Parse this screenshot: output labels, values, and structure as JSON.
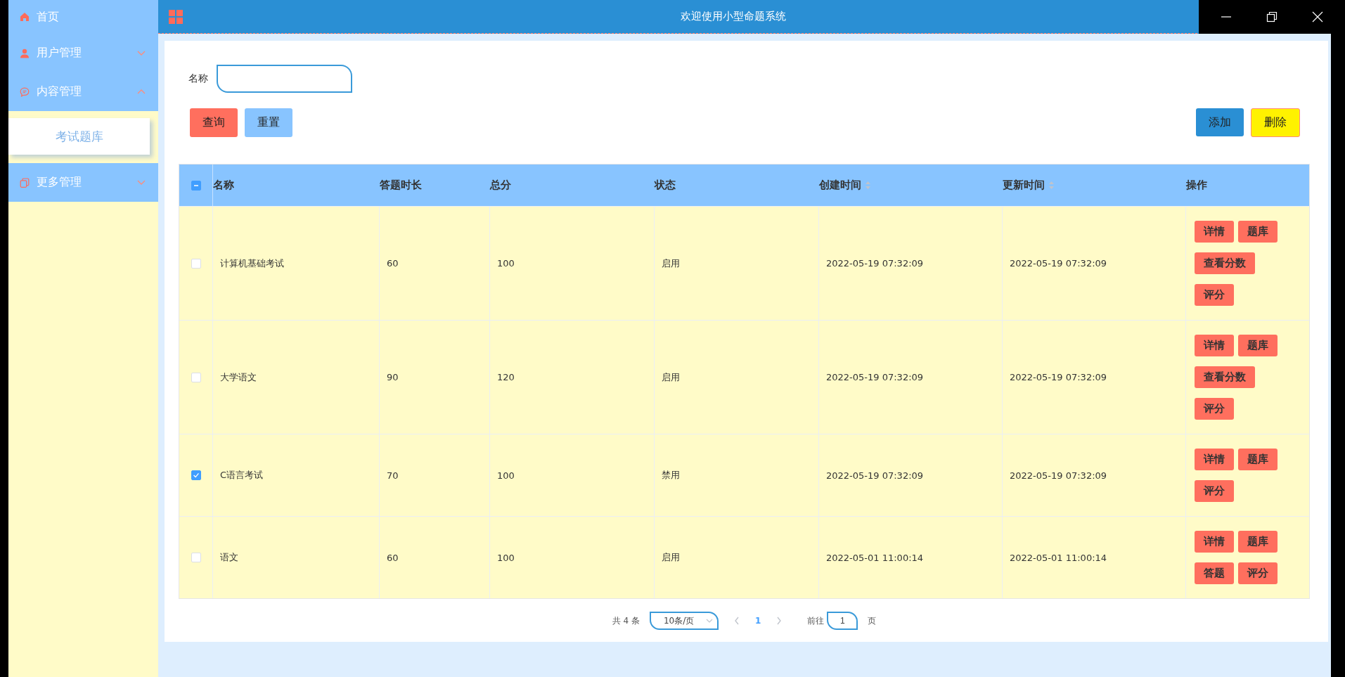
{
  "header": {
    "title": "欢迎使用小型命题系统"
  },
  "sidebar": {
    "items": [
      {
        "kind": "link",
        "label": "首页"
      },
      {
        "kind": "group",
        "label": "用户管理",
        "expanded": false
      },
      {
        "kind": "group",
        "label": "内容管理",
        "expanded": true,
        "children": [
          {
            "label": "考试题库",
            "selected": true
          }
        ]
      },
      {
        "kind": "group",
        "label": "更多管理",
        "expanded": false
      }
    ]
  },
  "search": {
    "label": "名称"
  },
  "buttons_left": [
    {
      "label": "查询",
      "kind": "danger"
    },
    {
      "label": "重置",
      "kind": "plain"
    }
  ],
  "buttons_right": [
    {
      "label": "添加",
      "kind": "primary"
    },
    {
      "label": "删除",
      "kind": "warning"
    }
  ],
  "table": {
    "partly_selected": true,
    "columns": [
      {
        "label": "名称",
        "sortable": false
      },
      {
        "label": "答题时长",
        "sortable": false
      },
      {
        "label": "总分",
        "sortable": false
      },
      {
        "label": "状态",
        "sortable": false
      },
      {
        "label": "创建时间",
        "sortable": true
      },
      {
        "label": "更新时间",
        "sortable": true
      },
      {
        "label": "操作",
        "sortable": false
      }
    ],
    "rows": [
      {
        "selected": false,
        "cells": [
          "计算机基础考试",
          "60",
          "100",
          "启用",
          "2022-05-19 07:32:09",
          "2022-05-19 07:32:09"
        ],
        "actions": [
          "详情",
          "题库",
          "查看分数",
          "评分"
        ]
      },
      {
        "selected": false,
        "cells": [
          "大学语文",
          "90",
          "120",
          "启用",
          "2022-05-19 07:32:09",
          "2022-05-19 07:32:09"
        ],
        "actions": [
          "详情",
          "题库",
          "查看分数",
          "评分"
        ]
      },
      {
        "selected": true,
        "cells": [
          "C语言考试",
          "70",
          "100",
          "禁用",
          "2022-05-19 07:32:09",
          "2022-05-19 07:32:09"
        ],
        "actions": [
          "详情",
          "题库",
          "评分"
        ]
      },
      {
        "selected": false,
        "cells": [
          "语文",
          "60",
          "100",
          "启用",
          "2022-05-01 11:00:14",
          "2022-05-01 11:00:14"
        ],
        "actions": [
          "详情",
          "题库",
          "答题",
          "评分"
        ]
      }
    ]
  },
  "pagination": {
    "total": "共 4 条",
    "page_size": "10条/页",
    "pages": [
      {
        "label": "1",
        "selected": true
      }
    ],
    "goto_label": "前往",
    "goto_value": "1",
    "goto_suffix": "页"
  }
}
